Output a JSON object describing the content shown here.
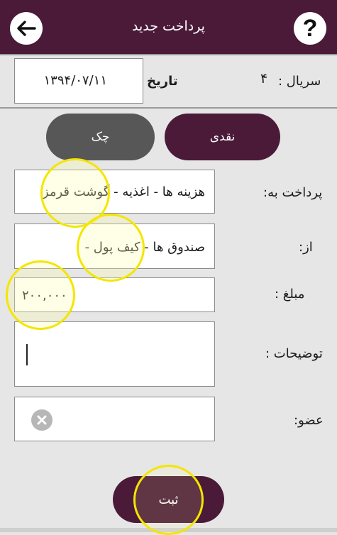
{
  "header": {
    "title": "پرداخت جدید",
    "back_icon": "arrow-left-icon",
    "help_icon": "question-icon",
    "help_glyph": "?",
    "background": "#4a1a38"
  },
  "meta_row": {
    "serial_label": "سریال :",
    "serial_value": "۴",
    "date_label": "تاریخ",
    "date_value": "۱۳۹۴/۰۷/۱۱"
  },
  "payment_type": {
    "cheque_label": "چک",
    "cash_label": "نقدی",
    "selected": "نقدی",
    "cheque_color": "#575757",
    "cash_color": "#4a1a38"
  },
  "form": {
    "pay_to_label": "پرداخت به:",
    "pay_to_value": "هزینه ها - اغذیه - گوشت قرمز",
    "from_label": "از:",
    "from_value": "صندوق ها - کیف پول -",
    "amount_label": "مبلغ :",
    "amount_value": "۲۰۰,۰۰۰",
    "description_label": "توضیحات :",
    "description_value": "",
    "member_label": "عضو:",
    "member_clear_icon": "clear-icon"
  },
  "submit": {
    "label": "ثبت"
  },
  "highlight_color": "#f3e600"
}
